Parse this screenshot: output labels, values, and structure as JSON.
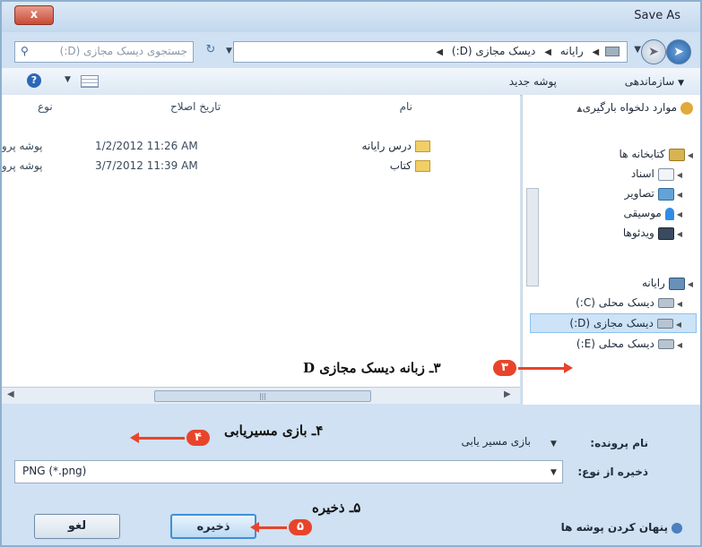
{
  "window": {
    "title": "Save As",
    "close_label": "x"
  },
  "nav": {
    "back_icon": "back-arrow-icon",
    "forward_icon": "forward-arrow-icon"
  },
  "address": {
    "crumbs": [
      "رایانه",
      "دیسک مجازی (D:)"
    ]
  },
  "search": {
    "placeholder": "جستجوی دیسک مجازی (D:)"
  },
  "toolbar": {
    "organize_label": "سازماندهی",
    "new_folder_label": "پوشه جدید"
  },
  "nav_pane": {
    "favorites": "موارد دلخواه بارگیری",
    "libraries": "کتابخانه ها",
    "documents": "اسناد",
    "pictures": "تصاویر",
    "music": "موسیقی",
    "videos": "ویدئوها",
    "computer": "رایانه",
    "drive_c": "دیسک محلی (C:)",
    "drive_d": "دیسک مجازی (D:)",
    "drive_e": "دیسک محلی (E:)"
  },
  "columns": {
    "name": "نام",
    "date": "تاریخ اصلاح",
    "type": "نوع"
  },
  "files": [
    {
      "name": "درس رایانه",
      "date": "1/2/2012 11:26 AM",
      "type": "پوشه پرونده"
    },
    {
      "name": "کتاب",
      "date": "3/7/2012 11:39 AM",
      "type": "پوشه پرونده"
    }
  ],
  "form": {
    "filename_label": "نام پرونده:",
    "filename_value": "بازی مسیر یابی",
    "savetype_label": "ذخیره از نوع:",
    "savetype_value": "PNG (*.png)",
    "hide_folders": "پنهان کردن پوشه ها",
    "save_label": "ذخیره",
    "cancel_label": "لغو"
  },
  "annotations": {
    "a3": {
      "num": "۳",
      "text": "۳ـ زبانه دیسک مجازی D"
    },
    "a4": {
      "num": "۴",
      "text": "۴ـ بازی مسیریابی"
    },
    "a5": {
      "num": "۵",
      "text": "۵ـ ذخیره"
    }
  },
  "colors": {
    "annotation": "#e8442b",
    "window_frame": "#cfe1f2",
    "selection": "#cde3f7"
  }
}
